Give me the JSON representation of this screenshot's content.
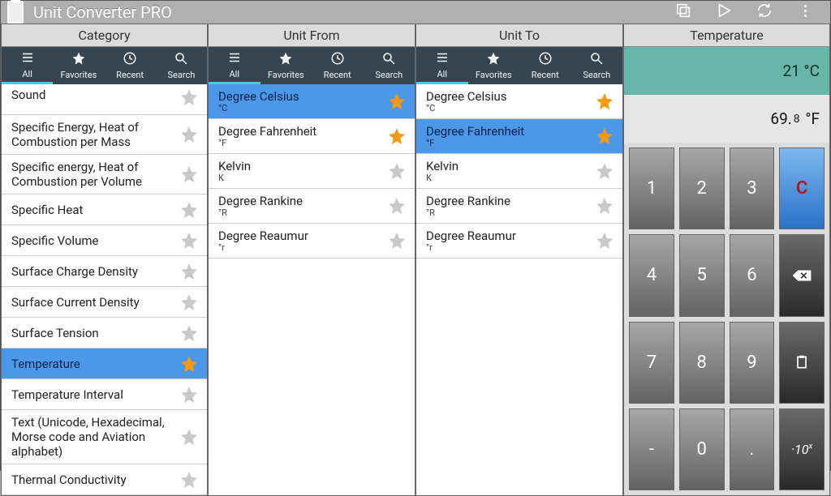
{
  "app": {
    "title": "Unit Converter PRO"
  },
  "columns": {
    "category": "Category",
    "unit_from": "Unit From",
    "unit_to": "Unit To",
    "display": "Temperature"
  },
  "tabs": {
    "all": "All",
    "favorites": "Favorites",
    "recent": "Recent",
    "search": "Search"
  },
  "categories": [
    {
      "name": "Sound",
      "fav": false,
      "cut": true
    },
    {
      "name": "Specific Energy, Heat of Combustion per Mass",
      "fav": false
    },
    {
      "name": "Specific energy, Heat of Combustion per Volume",
      "fav": false
    },
    {
      "name": "Specific Heat",
      "fav": false
    },
    {
      "name": "Specific Volume",
      "fav": false
    },
    {
      "name": "Surface Charge Density",
      "fav": false
    },
    {
      "name": "Surface Current Density",
      "fav": false
    },
    {
      "name": "Surface Tension",
      "fav": false
    },
    {
      "name": "Temperature",
      "fav": true,
      "selected": true
    },
    {
      "name": "Temperature Interval",
      "fav": false
    },
    {
      "name": "Text (Unicode, Hexadecimal, Morse code and Aviation alphabet)",
      "fav": false
    },
    {
      "name": "Thermal Conductivity",
      "fav": false
    }
  ],
  "units_from": [
    {
      "name": "Degree Celsius",
      "sym": "°C",
      "fav": true,
      "selected": true
    },
    {
      "name": "Degree Fahrenheit",
      "sym": "°F",
      "fav": true
    },
    {
      "name": "Kelvin",
      "sym": "K",
      "fav": false
    },
    {
      "name": "Degree Rankine",
      "sym": "°R",
      "fav": false
    },
    {
      "name": "Degree Reaumur",
      "sym": "°r",
      "fav": false
    }
  ],
  "units_to": [
    {
      "name": "Degree Celsius",
      "sym": "°C",
      "fav": true
    },
    {
      "name": "Degree Fahrenheit",
      "sym": "°F",
      "fav": true,
      "selected": true
    },
    {
      "name": "Kelvin",
      "sym": "K",
      "fav": false
    },
    {
      "name": "Degree Rankine",
      "sym": "°R",
      "fav": false
    },
    {
      "name": "Degree Reaumur",
      "sym": "°r",
      "fav": false
    }
  ],
  "readout": {
    "input_value": "21",
    "input_unit": "°C",
    "output_whole": "69.",
    "output_frac": "8",
    "output_unit": "°F"
  },
  "keys": {
    "k1": "1",
    "k2": "2",
    "k3": "3",
    "kC": "C",
    "k4": "4",
    "k5": "5",
    "k6": "6",
    "k7": "7",
    "k8": "8",
    "k9": "9",
    "kminus": "-",
    "k0": "0",
    "kdot": "."
  }
}
